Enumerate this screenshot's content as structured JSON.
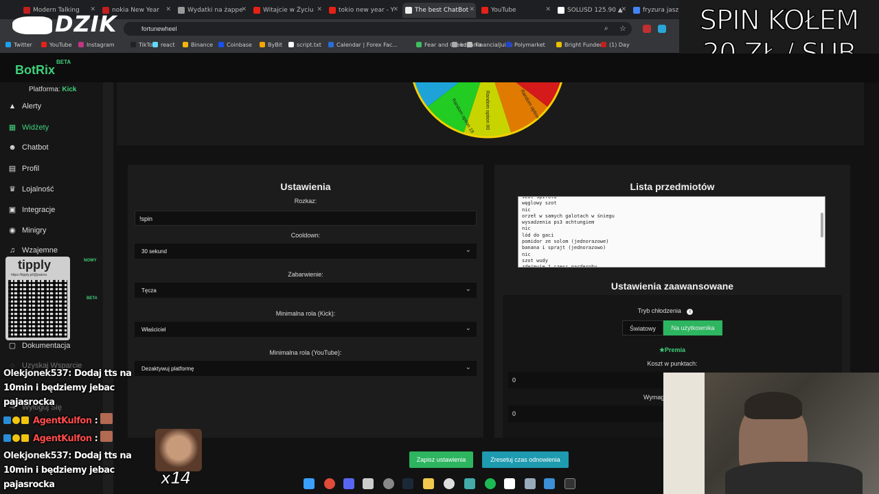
{
  "browser": {
    "tabs": [
      {
        "label": "Modern Talking",
        "color": "#c21f1f"
      },
      {
        "label": "nokia New Year",
        "color": "#c21f1f"
      },
      {
        "label": "Wydatki na żappe",
        "color": "#999999"
      },
      {
        "label": "Witajcie w Życiu",
        "color": "#e62117"
      },
      {
        "label": "tokio new year - Y",
        "color": "#e62117"
      },
      {
        "label": "The best ChatBot",
        "color": "#eeeeee"
      },
      {
        "label": "YouTube",
        "color": "#e62117"
      },
      {
        "label": "SOLUSD 125.90 ▲",
        "color": "#ffffff"
      },
      {
        "label": "fryzura jaszczur",
        "color": "#4285f4"
      }
    ],
    "url": "fortunewheel",
    "bookmarks": [
      "Twitter",
      "YouTube",
      "Instagram",
      "TikTok",
      "react",
      "Binance",
      "Coinbase",
      "ByBit",
      "script.txt",
      "Calendar | Forex Fac...",
      "Fear and Greed",
      "koparka",
      "FinancialJuice",
      "Polymarket",
      "Bright Funded",
      "(1) Day"
    ]
  },
  "overlay": {
    "brand": "DZIK",
    "promo_line1": "SPIN KOŁEM",
    "promo_line2": "20 ZŁ / SUB",
    "tipply_label": "tipply",
    "tipply_url": "https://tipply.pl/@patora",
    "emote_count": "x14",
    "chat": [
      {
        "user": "Olekjonek537",
        "msg": ": Dodaj tts na 10min i będziemy jebac pajasrocka"
      },
      {
        "user": "AgentKulfon",
        "msg": " : "
      },
      {
        "user": "AgentKulfon",
        "msg": " : "
      },
      {
        "user": "Olekjonek537",
        "msg": ": Dodaj tts na 10min i będziemy jebac pajasrocka"
      }
    ]
  },
  "app": {
    "name": "BotRix",
    "beta": "BETA",
    "platform_label": "Platforma:",
    "platform_value": "Kick",
    "nav": [
      {
        "label": "Alerty",
        "icon": "bell-icon",
        "glyph": "▲"
      },
      {
        "label": "Widżety",
        "icon": "widgets-icon",
        "glyph": "▦"
      },
      {
        "label": "Chatbot",
        "icon": "robot-icon",
        "glyph": "☻"
      },
      {
        "label": "Profil",
        "icon": "profile-icon",
        "glyph": "▤"
      },
      {
        "label": "Lojalność",
        "icon": "trophy-icon",
        "glyph": "♛"
      },
      {
        "label": "Integracje",
        "icon": "integrations-icon",
        "glyph": "▣"
      },
      {
        "label": "Minigry",
        "icon": "gamepad-icon",
        "glyph": "◉"
      },
      {
        "label": "Wzajemne",
        "icon": "music-icon",
        "glyph": "♫"
      },
      {
        "label": "Dokumentacja",
        "icon": "docs-icon",
        "glyph": "▢"
      },
      {
        "label": "Uzyskaj Wsparcie",
        "icon": "support-icon",
        "glyph": "◌"
      },
      {
        "label": "Wyloguj Się",
        "icon": "logout-icon",
        "glyph": "⇥"
      }
    ],
    "new_badge": "NOWY",
    "beta_badge": "BETA",
    "wheel_labels": [
      "Random option 19",
      "Random option 00",
      "Random option 02"
    ]
  },
  "settings": {
    "title": "Ustawienia",
    "command_label": "Rozkaz:",
    "command_value": "!spin",
    "cooldown_label": "Cooldown:",
    "cooldown_value": "30 sekund",
    "color_label": "Zabarwienie:",
    "color_value": "Tęcza",
    "min_role_kick_label": "Minimalna rola (Kick):",
    "min_role_kick_value": "Właściciel",
    "min_role_yt_label": "Minimalna rola (YouTube):",
    "min_role_yt_value": "Dezaktywuj platformę"
  },
  "items": {
    "title": "Lista przedmiotów",
    "lines": [
      "szot spirolu",
      "węglowy szot",
      "nic",
      "orzeł w samych galotach w śniegu",
      "wysadzenia ps3 achtungiem",
      "nic",
      "lód do gaci",
      "pomidor ze solom (jednorazowe)",
      "banana i sprajt (jednorazowo)",
      "nic",
      "szot wudy",
      "zdejmuje 1 czesc garderoby"
    ],
    "advanced_title": "Ustawienia zaawansowane",
    "cooldown_mode_label": "Tryb chłodzenia",
    "mode_global": "Światowy",
    "mode_user": "Na użytkownika",
    "premium_label": "Premia",
    "cost_label": "Koszt w punktach:",
    "cost_value": "0",
    "required_label": "Wymag",
    "required_value": "0"
  },
  "buttons": {
    "save": "Zapisz ustawienia",
    "reset": "Zresetuj czas odnowienia"
  },
  "colors": {
    "accent": "#3fd07a",
    "save_button": "#2db560",
    "reset_button": "#1e9bb0"
  }
}
